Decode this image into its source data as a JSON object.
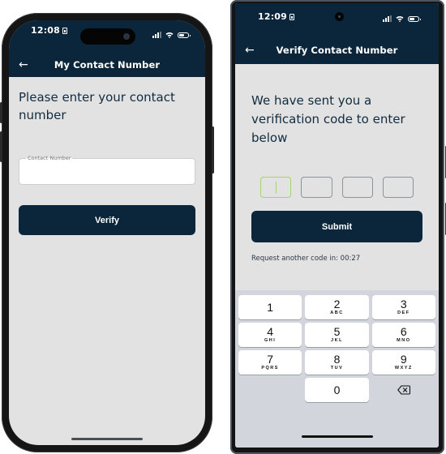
{
  "left_phone": {
    "status_bar": {
      "time": "12:08"
    },
    "header": {
      "back_icon": "arrow-left-icon",
      "title": "My Contact Number"
    },
    "heading": "Please enter your contact number",
    "contact_field": {
      "label": "Contact Number",
      "value": "",
      "placeholder": ""
    },
    "verify_button": "Verify"
  },
  "right_phone": {
    "status_bar": {
      "time": "12:09"
    },
    "header": {
      "back_icon": "arrow-left-icon",
      "title": "Verify Contact Number"
    },
    "heading": "We have sent you a verification code to enter below",
    "otp": {
      "length": 4,
      "values": [
        "",
        "",
        "",
        ""
      ],
      "active_index": 0
    },
    "submit_button": "Submit",
    "resend_text": "Request another code in: 00:27",
    "keypad": {
      "keys": [
        {
          "num": "1",
          "letters": ""
        },
        {
          "num": "2",
          "letters": "ABC"
        },
        {
          "num": "3",
          "letters": "DEF"
        },
        {
          "num": "4",
          "letters": "GHI"
        },
        {
          "num": "5",
          "letters": "JKL"
        },
        {
          "num": "6",
          "letters": "MNO"
        },
        {
          "num": "7",
          "letters": "PQRS"
        },
        {
          "num": "8",
          "letters": "TUV"
        },
        {
          "num": "9",
          "letters": "WXYZ"
        },
        {
          "num": "0",
          "letters": ""
        }
      ],
      "backspace_icon": "backspace-icon"
    }
  },
  "colors": {
    "primary": "#0b253a",
    "screen_bg": "#e2e2e2",
    "otp_active": "#a8d26b",
    "keypad_bg": "#d2d5db"
  }
}
